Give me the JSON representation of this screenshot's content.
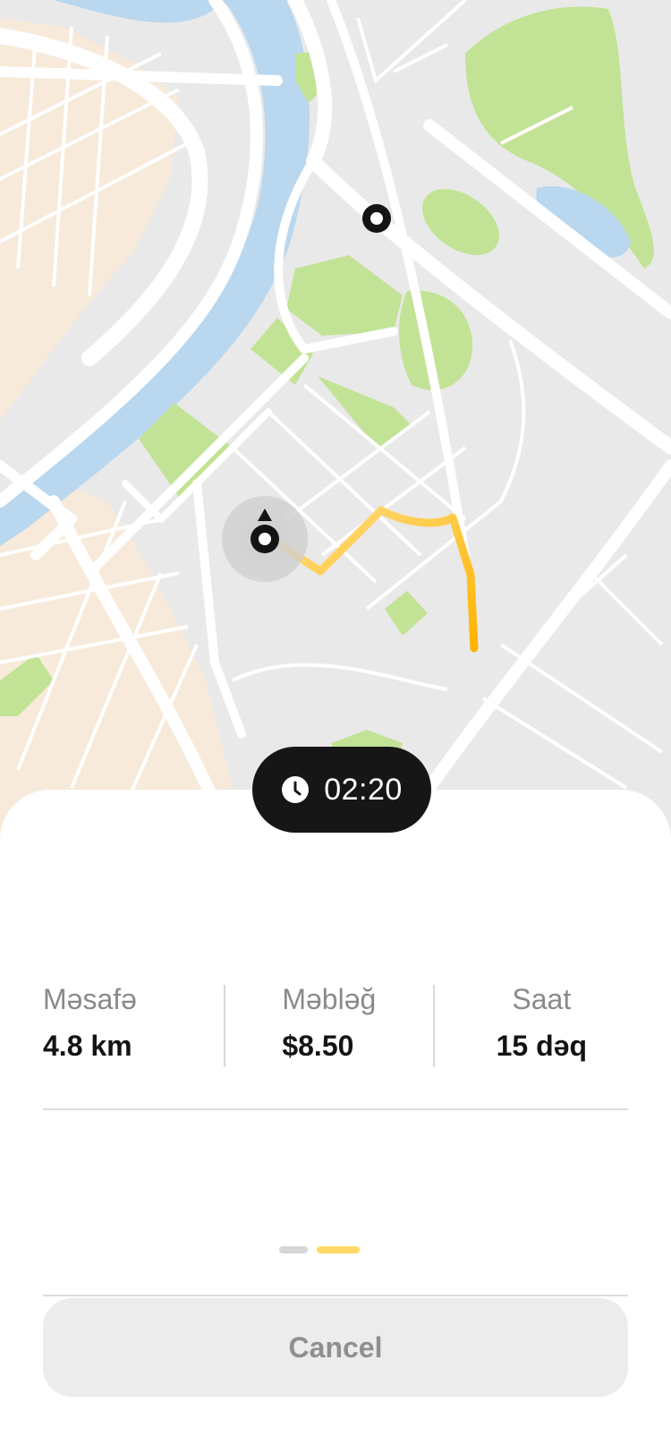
{
  "map": {
    "water_color": "#b9d7ee",
    "park_color": "#c2e395",
    "sand_color": "#f7eada",
    "road_color": "#ffffff",
    "land_color": "#e9e9e9",
    "route_color_start": "#ffe08a",
    "route_color_end": "#ffb300"
  },
  "timer": {
    "icon": "clock-icon",
    "time": "02:20"
  },
  "stats": {
    "distance": {
      "label": "Məsafə",
      "value": "4.8 km"
    },
    "amount": {
      "label": "Məbləğ",
      "value": "$8.50"
    },
    "time": {
      "label": "Saat",
      "value": "15 dəq"
    }
  },
  "pager": {
    "active_index": 1,
    "count": 2
  },
  "cancel": {
    "label": "Cancel"
  }
}
